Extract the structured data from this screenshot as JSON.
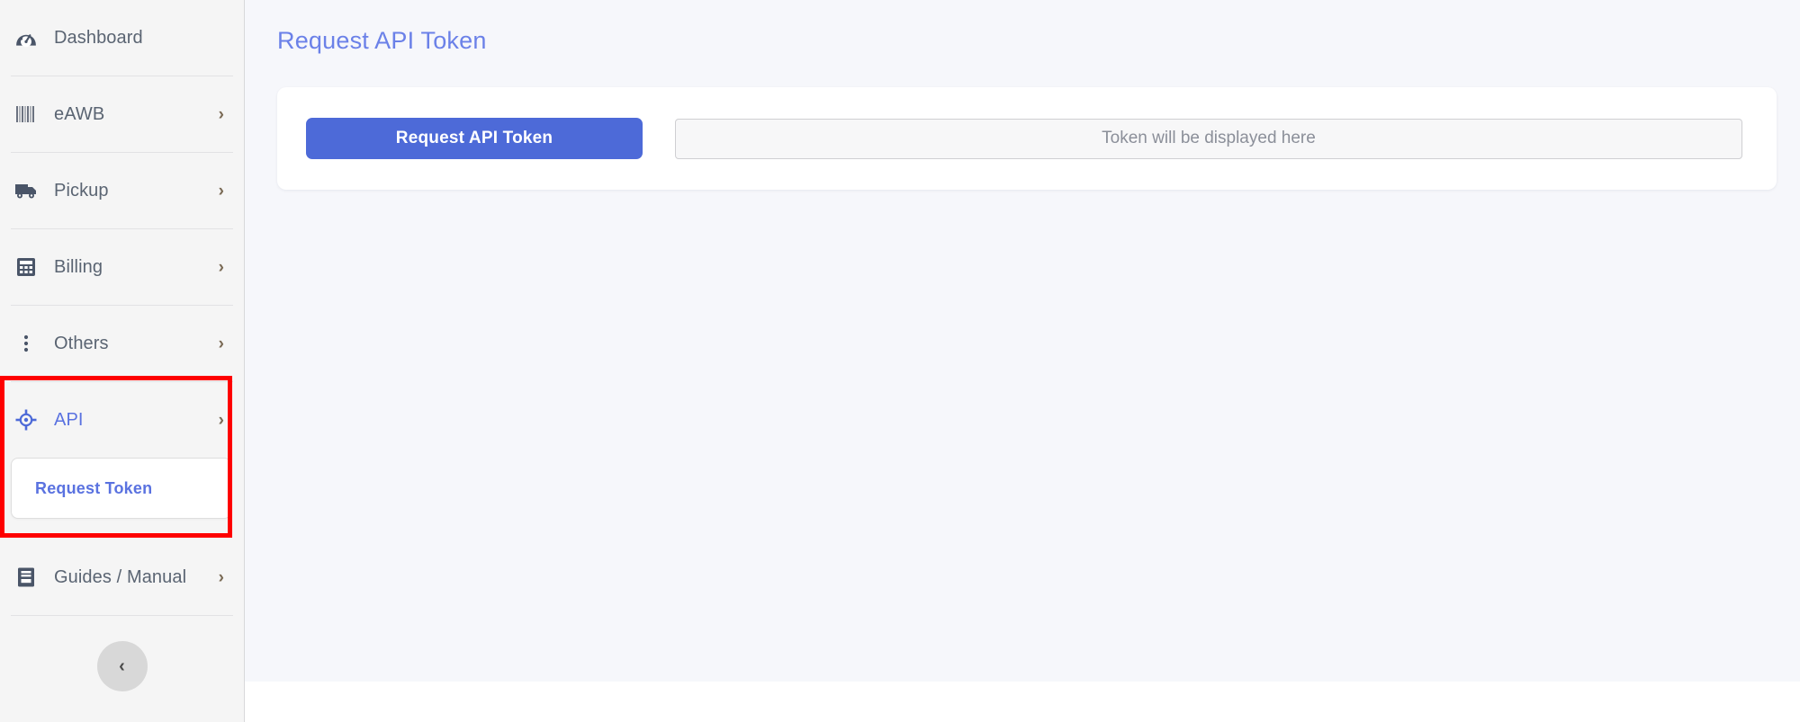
{
  "sidebar": {
    "items": [
      {
        "label": "Dashboard",
        "icon": "speedometer-icon",
        "has_chevron": false,
        "active": false
      },
      {
        "label": "eAWB",
        "icon": "barcode-icon",
        "has_chevron": true,
        "active": false
      },
      {
        "label": "Pickup",
        "icon": "truck-icon",
        "has_chevron": true,
        "active": false
      },
      {
        "label": "Billing",
        "icon": "calculator-icon",
        "has_chevron": true,
        "active": false
      },
      {
        "label": "Others",
        "icon": "dots-vertical-icon",
        "has_chevron": true,
        "active": false
      },
      {
        "label": "API",
        "icon": "crosshair-icon",
        "has_chevron": true,
        "active": true
      },
      {
        "label": "Guides / Manual",
        "icon": "book-icon",
        "has_chevron": true,
        "active": false
      }
    ],
    "api_subitems": [
      {
        "label": "Request Token",
        "active": true
      }
    ],
    "collapse_button": {
      "icon": "chevron-left-icon",
      "label": "‹"
    },
    "chevron_glyph": "›"
  },
  "main": {
    "page_title": "Request API Token",
    "card": {
      "request_button_label": "Request API Token",
      "token_field_placeholder": "Token will be displayed here",
      "token_field_value": ""
    }
  },
  "annotation": {
    "highlight_color": "#fe0000",
    "target": "API"
  },
  "colors": {
    "accent_blue": "#4d6ad8",
    "title_blue": "#6b81e8",
    "sidebar_bg": "#f5f5f5",
    "main_bg": "#f6f7fb",
    "muted_text": "#5a6472"
  }
}
